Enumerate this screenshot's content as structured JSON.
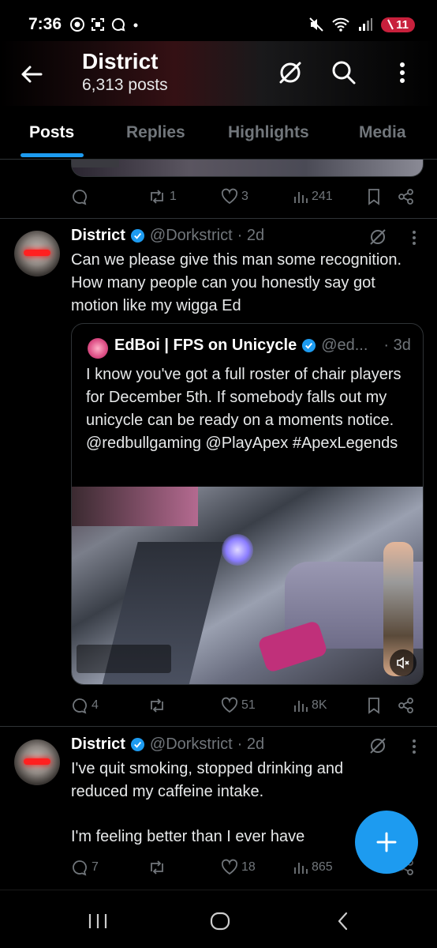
{
  "status_bar": {
    "time": "7:36",
    "battery": "11"
  },
  "header": {
    "title": "District",
    "subtitle": "6,313 posts"
  },
  "tabs": [
    {
      "label": "Posts",
      "active": true
    },
    {
      "label": "Replies",
      "active": false
    },
    {
      "label": "Highlights",
      "active": false
    },
    {
      "label": "Media",
      "active": false
    }
  ],
  "prev_post": {
    "replies": "",
    "reposts": "1",
    "likes": "3",
    "views": "241"
  },
  "post1": {
    "name": "District",
    "handle": "@Dorkstrict",
    "time": "· 2d",
    "text": "Can we please give this man some recognition. How many people can you honestly say got motion like my wigga Ed",
    "quote": {
      "name": "EdBoi | FPS on Unicycle",
      "handle": "@ed...",
      "time": "· 3d",
      "text": "I know you've got a full roster of chair players for December 5th. If somebody falls out my unicycle can be ready on a moments notice. @redbullgaming @PlayApex  #ApexLegends"
    },
    "replies": "4",
    "reposts": "",
    "likes": "51",
    "views": "8K"
  },
  "post2": {
    "name": "District",
    "handle": "@Dorkstrict",
    "time": "· 2d",
    "text_line1": "I've quit smoking, stopped drinking and reduced my caffeine intake.",
    "text_line2": "I'm feeling better than I ever have",
    "replies": "7",
    "reposts": "",
    "likes": "18",
    "views": "865"
  },
  "colors": {
    "accent": "#1d9bf0",
    "muted": "#71767b",
    "background": "#000000"
  }
}
